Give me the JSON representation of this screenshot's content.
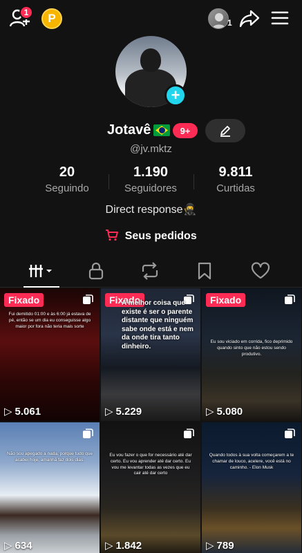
{
  "topbar": {
    "friend_requests_count": "1",
    "coin_label": "P",
    "avatar_count": "1"
  },
  "profile": {
    "name": "Jotavê",
    "flag_icon": "brazil-flag-icon",
    "badge": "9+",
    "handle": "@jv.mktz",
    "bio": "Direct response🥷",
    "orders_label": "Seus pedidos"
  },
  "stats": [
    {
      "value": "20",
      "label": "Seguindo"
    },
    {
      "value": "1.190",
      "label": "Seguidores"
    },
    {
      "value": "9.811",
      "label": "Curtidas"
    }
  ],
  "colors": {
    "accent": "#fe2c55",
    "follow": "#20d5ec",
    "background": "#121212"
  },
  "tabs": [
    "videos-grid",
    "private-lock",
    "reposts",
    "favorites-bookmark",
    "liked-heart"
  ],
  "videos": [
    {
      "pinned_label": "Fixado",
      "views": "5.061",
      "caption": "Fui demitido 01:00 e às 6:00 já estava de pé, então se um dia eu conseguisse algo maior por fora não teria mais sorte"
    },
    {
      "pinned_label": "Fixado",
      "views": "5.229",
      "caption": "A melhor coisa que existe é ser o parente distante que ninguém sabe onde está e nem da onde tira tanto dinheiro."
    },
    {
      "pinned_label": "Fixado",
      "views": "5.080",
      "caption": "Eu sou viciado em corrida, fico deprimido quando sinto que não estou sendo produtivo."
    },
    {
      "pinned_label": "",
      "views": "634",
      "caption": "Não sou apegado a nada, porque tudo que acabei hoje, amanhã faz dois dias."
    },
    {
      "pinned_label": "",
      "views": "1.842",
      "caption": "Eu vou fazer o que for necessário até dar certo. Eu vou aprender até dar certo. Eu vou me levantar todas as vezes que eu cair até dar certo"
    },
    {
      "pinned_label": "",
      "views": "789",
      "caption": "Quando todos à sua volta começarem a te chamar de louco, acelere, você está no caminho. - Elon Musk"
    }
  ]
}
